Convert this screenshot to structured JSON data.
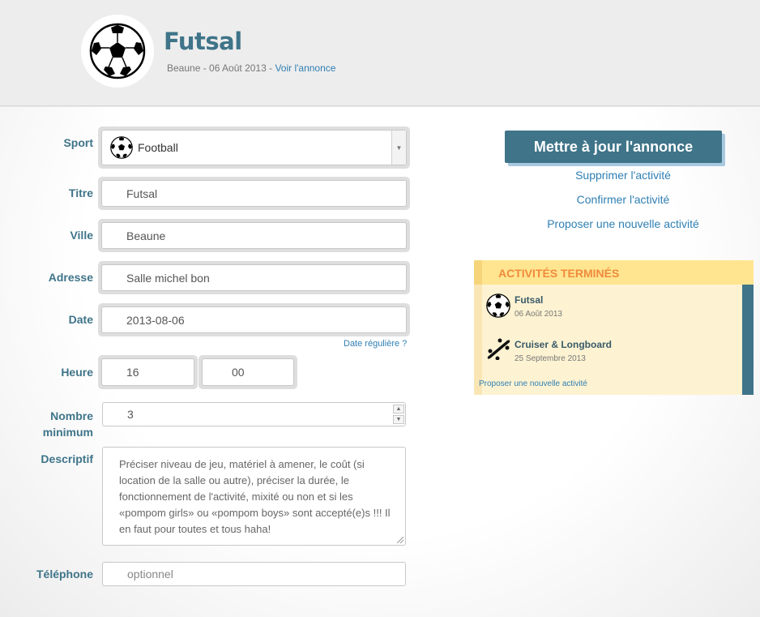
{
  "header": {
    "title": "Futsal",
    "subtitle": "Beaune - 06 Août 2013 - ",
    "link": "Voir l'annonce",
    "logo_icon": "soccer-ball-icon"
  },
  "form": {
    "sport": {
      "label": "Sport",
      "value": "Football",
      "icon": "soccer-ball-icon"
    },
    "titre": {
      "label": "Titre",
      "value": "Futsal"
    },
    "ville": {
      "label": "Ville",
      "value": "Beaune"
    },
    "adresse": {
      "label": "Adresse",
      "value": "Salle michel bon"
    },
    "date": {
      "label": "Date",
      "value": "2013-08-06",
      "link": "Date régulière ?"
    },
    "heure": {
      "label": "Heure",
      "hours": "16",
      "minutes": "00"
    },
    "nombre": {
      "label_line1": "Nombre",
      "label_line2": "minimum",
      "value": "3"
    },
    "description": {
      "label": "Descriptif",
      "placeholder": "Préciser niveau de jeu, matériel à amener, le coût (si location de la salle ou autre), préciser la durée, le fonctionnement de l'activité, mixité ou non et si les «pompom girls» ou «pompom boys» sont accepté(e)s !!! Il en faut pour toutes et tous haha!"
    },
    "telephone": {
      "label": "Téléphone",
      "placeholder": "optionnel"
    }
  },
  "actions": {
    "update": "Mettre à jour l'annonce",
    "delete": "Supprimer l'activité",
    "confirm": "Confirmer l'activité",
    "propose": "Proposer une nouvelle activité"
  },
  "panel": {
    "title": "ACTIVITÉS TERMINÉS",
    "items": [
      {
        "title": "Futsal",
        "date": "06 Août 2013",
        "icon": "soccer-ball-icon"
      },
      {
        "title": "Cruiser & Longboard",
        "date": "25 Septembre 2013",
        "icon": "skateboard-icon"
      }
    ],
    "link": "Proposer une nouvelle activité"
  },
  "colors": {
    "accent": "#3f7489",
    "link": "#2f7fb3",
    "panel_title": "#f08a3c",
    "panel_bg": "#fdf3d2",
    "panel_head": "#ffe590"
  }
}
